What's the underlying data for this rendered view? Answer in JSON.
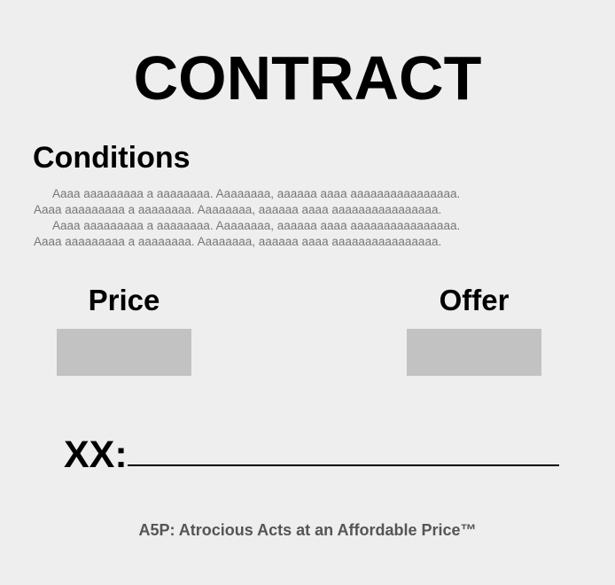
{
  "document": {
    "title": "CONTRACT",
    "section_heading": "Conditions",
    "paragraphs": [
      "Aaaa aaaaaaaaa a aaaaaaaa. Aaaaaaaa, aaaaaa aaaa aaaaaaaaaaaaaaaa.",
      "Aaaa aaaaaaaaa a aaaaaaaa. Aaaaaaaa, aaaaaa aaaa aaaaaaaaaaaaaaaa.",
      "Aaaa aaaaaaaaa a aaaaaaaa. Aaaaaaaa, aaaaaa aaaa aaaaaaaaaaaaaaaa.",
      "Aaaa aaaaaaaaa a aaaaaaaa. Aaaaaaaa, aaaaaa aaaa aaaaaaaaaaaaaaaa."
    ],
    "price_label": "Price",
    "offer_label": "Offer",
    "signature_label": "XX:",
    "tagline": "A5P: Atrocious Acts at an Affordable Price™"
  },
  "colors": {
    "background": "#eeeeee",
    "field_fill": "#c2c2c2",
    "body_text": "#777777",
    "tagline_text": "#555555"
  }
}
